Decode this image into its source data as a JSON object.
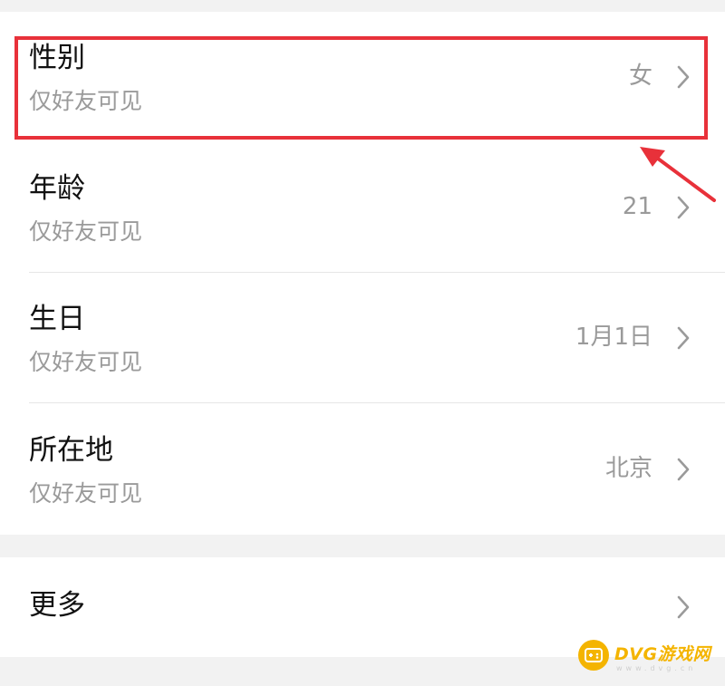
{
  "profile": {
    "rows": [
      {
        "title": "性别",
        "subtitle": "仅好友可见",
        "value": "女"
      },
      {
        "title": "年龄",
        "subtitle": "仅好友可见",
        "value": "21"
      },
      {
        "title": "生日",
        "subtitle": "仅好友可见",
        "value": "1月1日"
      },
      {
        "title": "所在地",
        "subtitle": "仅好友可见",
        "value": "北京"
      }
    ],
    "more": {
      "title": "更多"
    }
  },
  "annotation": {
    "highlight_color": "#e8313a"
  },
  "watermark": {
    "text": "DVG游戏网",
    "sub": "www.dvg.cn",
    "color": "#f4b400"
  },
  "icons": {
    "chevron": "chevron-right-icon",
    "watermark_logo": "gamepad-icon"
  }
}
